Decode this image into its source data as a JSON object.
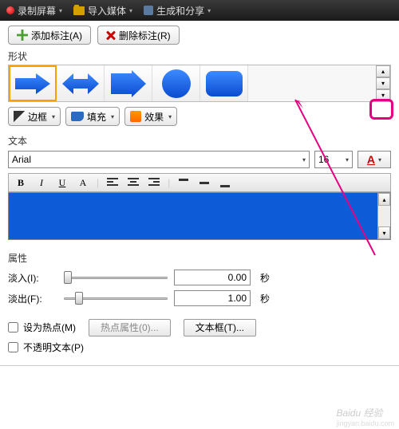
{
  "menubar": {
    "record": "录制屏幕",
    "import": "导入媒体",
    "share": "生成和分享"
  },
  "buttons": {
    "add_callout": "添加标注(A)",
    "remove_callout": "删除标注(R)"
  },
  "sections": {
    "shape": "形状",
    "text": "文本",
    "properties": "属性"
  },
  "tools": {
    "border": "边框",
    "fill": "填充",
    "effects": "效果"
  },
  "font": {
    "name": "Arial",
    "size": "16"
  },
  "format": {
    "bold": "B",
    "italic": "I",
    "underline": "U",
    "fontcolor": "A"
  },
  "props": {
    "fadein_label": "淡入(I):",
    "fadein_value": "0.00",
    "fadeout_label": "淡出(F):",
    "fadeout_value": "1.00",
    "unit": "秒"
  },
  "checks": {
    "hotspot": "设为热点(M)",
    "opaque": "不透明文本(P)"
  },
  "bottom": {
    "hotspot_props": "热点属性(0)...",
    "textbox": "文本框(T)..."
  },
  "colors": {
    "shape_fill": "#0e5bd8",
    "highlight": "#e4007f",
    "pointer": "#e4007f"
  },
  "watermark": {
    "main": "Baidu 经验",
    "sub": "jingyan.baidu.com"
  }
}
